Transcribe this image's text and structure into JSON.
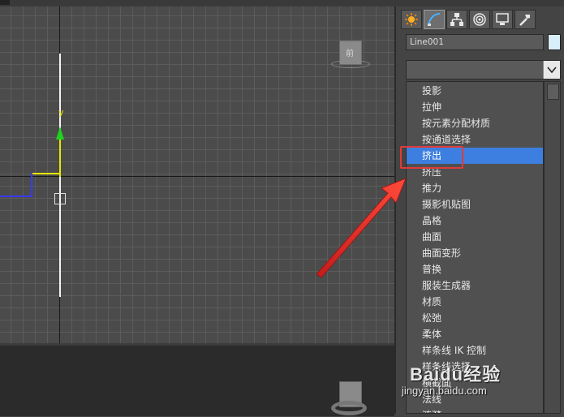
{
  "viewport": {
    "axis_label_y": "y",
    "viewcube_label": "前"
  },
  "command_panel": {
    "tabs": [
      {
        "icon": "create-icon"
      },
      {
        "icon": "modify-icon",
        "active": true
      },
      {
        "icon": "hierarchy-icon"
      },
      {
        "icon": "motion-icon"
      },
      {
        "icon": "display-icon"
      },
      {
        "icon": "utilities-icon"
      }
    ],
    "object_name": "Line001",
    "object_color": "#d8eef8",
    "modifier_list_value": "",
    "modifier_list": [
      "投影",
      "拉伸",
      "按元素分配材质",
      "按通道选择",
      "挤出",
      "挤压",
      "推力",
      "摄影机贴图",
      "晶格",
      "曲面",
      "曲面变形",
      "普换",
      "服装生成器",
      "材质",
      "松弛",
      "柔体",
      "样条线 IK 控制",
      "样条线选择",
      "横截面",
      "法线",
      "涟漪"
    ],
    "selected_index": 4
  },
  "annotation": {
    "highlight_color": "#e23a3a"
  },
  "watermark": {
    "brand": "Baidu经验",
    "site": "jingyan.baidu.com"
  },
  "colors": {
    "selection_blue": "#3d7fe0",
    "grid": "#5c5c5c",
    "gizmo_green": "#1fd21f",
    "gizmo_yellow": "#e6e600"
  }
}
